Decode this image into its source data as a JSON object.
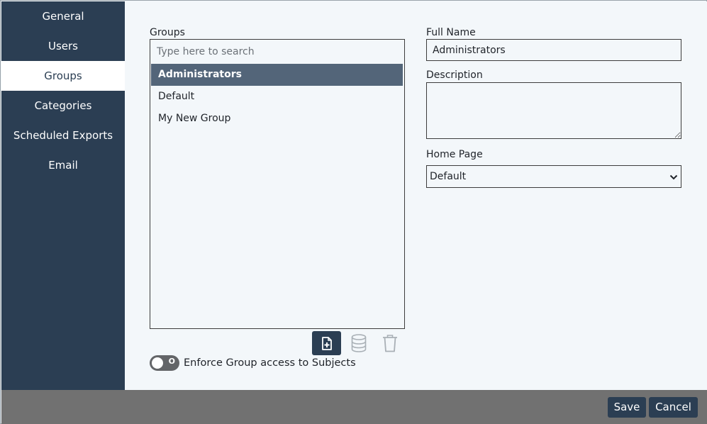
{
  "sidebar": {
    "items": [
      {
        "label": "General",
        "active": false
      },
      {
        "label": "Users",
        "active": false
      },
      {
        "label": "Groups",
        "active": true
      },
      {
        "label": "Categories",
        "active": false
      },
      {
        "label": "Scheduled Exports",
        "active": false
      },
      {
        "label": "Email",
        "active": false
      }
    ]
  },
  "groups": {
    "label": "Groups",
    "search_placeholder": "Type here to search",
    "items": [
      {
        "label": "Administrators",
        "selected": true
      },
      {
        "label": "Default",
        "selected": false
      },
      {
        "label": "My New Group",
        "selected": false
      }
    ],
    "toolbar": {
      "add_icon": "add-file-icon",
      "database_icon": "database-icon",
      "delete_icon": "trash-icon"
    },
    "enforce_toggle": {
      "label": "Enforce Group access to Subjects",
      "state_text": "O"
    }
  },
  "details": {
    "full_name_label": "Full Name",
    "full_name_value": "Administrators",
    "description_label": "Description",
    "description_value": "",
    "home_page_label": "Home Page",
    "home_page_value": "Default"
  },
  "footer": {
    "save_label": "Save",
    "cancel_label": "Cancel"
  },
  "colors": {
    "sidebar_bg": "#2b3e53",
    "selected_row": "#536579",
    "footer_bg": "#717171",
    "page_bg": "#f3f7fa"
  }
}
